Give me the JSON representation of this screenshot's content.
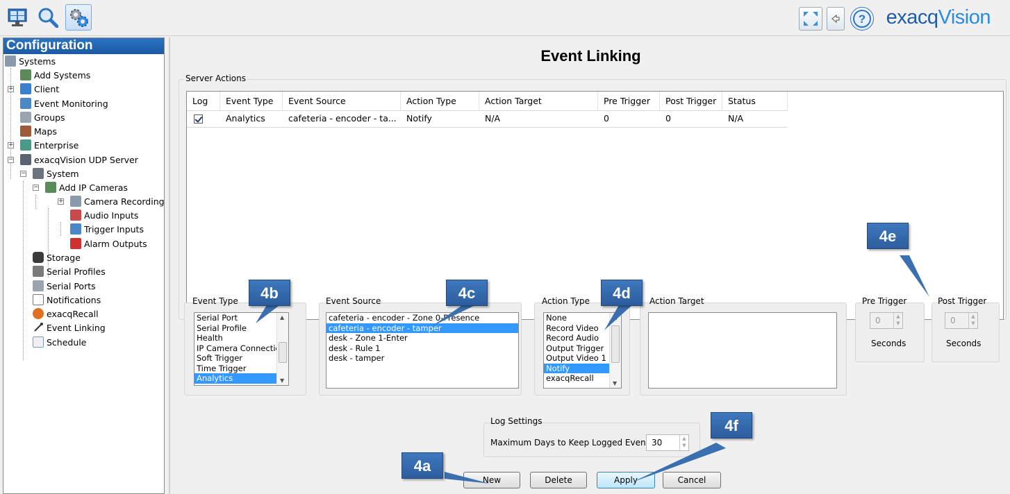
{
  "toolbar": {
    "buttons": [
      {
        "name": "live-view-icon"
      },
      {
        "name": "search-icon"
      },
      {
        "name": "config-gear-icon"
      }
    ],
    "right_buttons": [
      {
        "name": "fullscreen-icon"
      },
      {
        "name": "back-arrow-icon"
      },
      {
        "name": "help-icon"
      }
    ],
    "logo_prefix": "exacq",
    "logo_suffix": "Vision"
  },
  "sidebar": {
    "title": "Configuration",
    "items": [
      {
        "label": "Systems"
      },
      {
        "label": "Add Systems"
      },
      {
        "label": "Client"
      },
      {
        "label": "Event Monitoring"
      },
      {
        "label": "Groups"
      },
      {
        "label": "Maps"
      },
      {
        "label": "Enterprise"
      },
      {
        "label": "exacqVision UDP Server"
      },
      {
        "label": "System"
      },
      {
        "label": "Add IP Cameras"
      },
      {
        "label": "Camera Recording"
      },
      {
        "label": "Audio Inputs"
      },
      {
        "label": "Trigger Inputs"
      },
      {
        "label": "Alarm Outputs"
      },
      {
        "label": "Storage"
      },
      {
        "label": "Serial Profiles"
      },
      {
        "label": "Serial Ports"
      },
      {
        "label": "Notifications"
      },
      {
        "label": "exacqRecall"
      },
      {
        "label": "Event Linking"
      },
      {
        "label": "Schedule"
      }
    ]
  },
  "main": {
    "title": "Event Linking",
    "server_actions_label": "Server Actions",
    "table": {
      "columns": [
        "Log",
        "Event Type",
        "Event Source",
        "Action Type",
        "Action Target",
        "Pre Trigger",
        "Post Trigger",
        "Status"
      ],
      "rows": [
        {
          "log": true,
          "event_type": "Analytics",
          "event_source": "cafeteria - encoder - ta...",
          "action_type": "Notify",
          "action_target": "N/A",
          "pre_trigger": "0",
          "post_trigger": "0",
          "status": "N/A"
        }
      ]
    },
    "event_type": {
      "label": "Event Type",
      "options": [
        "Serial Port",
        "Serial Profile",
        "Health",
        "IP Camera Connection",
        "Soft Trigger",
        "Time Trigger",
        "Analytics"
      ],
      "selected": "Analytics"
    },
    "event_source": {
      "label": "Event Source",
      "options": [
        "cafeteria - encoder - Zone 0-Presence",
        "cafeteria - encoder - tamper",
        "desk - Zone 1-Enter",
        "desk - Rule 1",
        "desk - tamper"
      ],
      "selected": "cafeteria - encoder - tamper"
    },
    "action_type": {
      "label": "Action Type",
      "options": [
        "None",
        "Record Video",
        "Record Audio",
        "Output Trigger",
        "Output Video 1",
        "Notify",
        "exacqRecall"
      ],
      "selected": "Notify"
    },
    "action_target": {
      "label": "Action Target"
    },
    "pre_trigger": {
      "label": "Pre Trigger",
      "value": "0",
      "unit": "Seconds"
    },
    "post_trigger": {
      "label": "Post Trigger",
      "value": "0",
      "unit": "Seconds"
    },
    "log_settings": {
      "label": "Log Settings",
      "max_days_label": "Maximum Days to Keep Logged Events:",
      "max_days_value": "30"
    },
    "buttons": {
      "new": "New",
      "delete": "Delete",
      "apply": "Apply",
      "cancel": "Cancel"
    }
  },
  "callouts": {
    "a": "4a",
    "b": "4b",
    "c": "4c",
    "d": "4d",
    "e": "4e",
    "f": "4f"
  },
  "colors": {
    "accent": "#1c5aa3",
    "selection": "#3399ff",
    "callout": "#3a6fb0"
  }
}
